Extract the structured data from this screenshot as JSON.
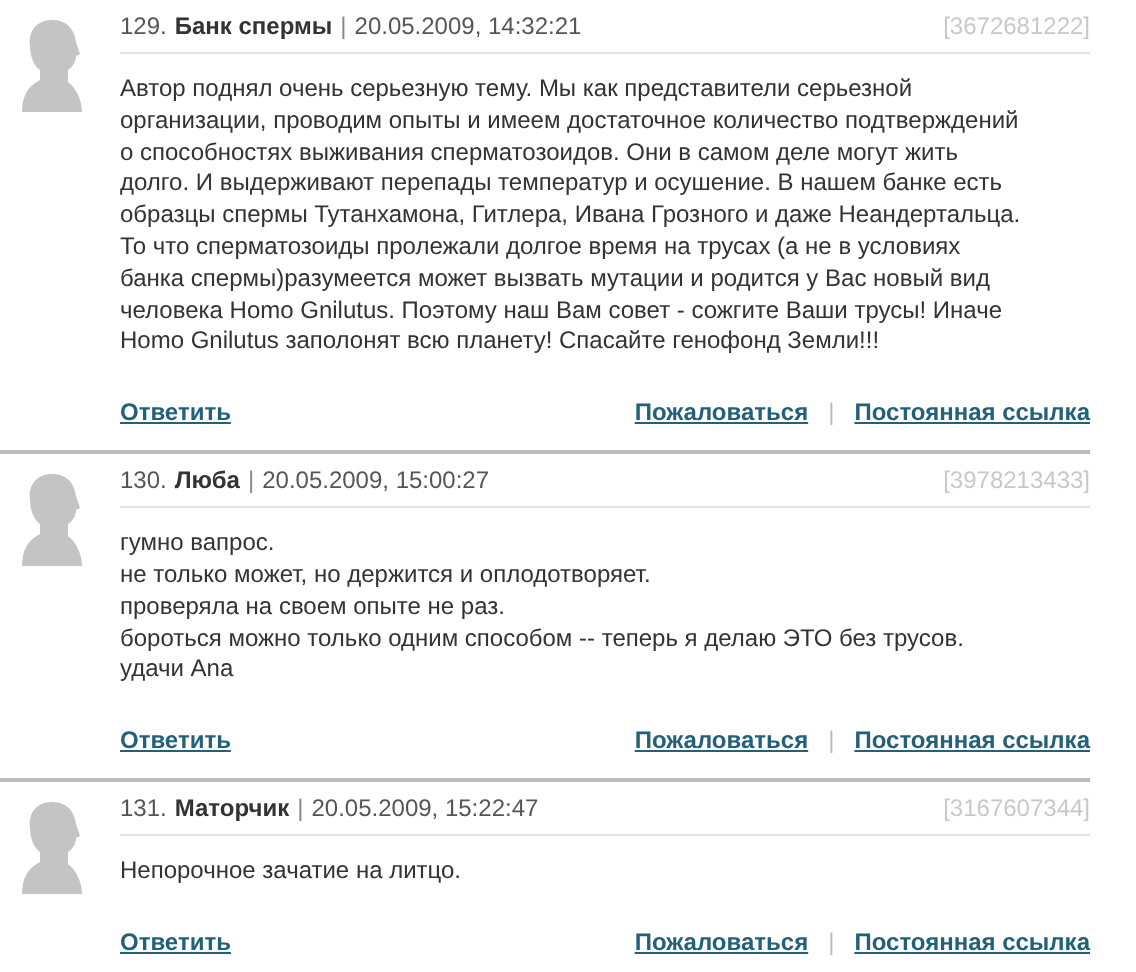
{
  "comments": [
    {
      "number": "129.",
      "author": "Банк спермы",
      "divider": "|",
      "date": "20.05.2009, 14:32:21",
      "id": "[3672681222]",
      "lines": [
        "Автор поднял очень серьезную тему. Мы как представители серьезной",
        "организации, проводим опыты и имеем достаточное количество подтверждений",
        "о способностях выживания сперматозоидов. Они в самом деле могут жить",
        "долго. И выдерживают перепады температур и осушение. В нашем банке есть",
        "образцы спермы Тутанхамона, Гитлера, Ивана Грозного и даже Неандертальца.",
        "То что сперматозоиды пролежали долгое время на трусах (а не в условиях",
        "банка спермы)разумеется может вызвать мутации и родится у Вас новый вид",
        "человека Homo Gnilutus. Поэтому наш Вам совет - сожгите Ваши трусы! Иначе",
        "Homo Gnilutus заполонят всю планету! Спасайте генофонд Земли!!!"
      ],
      "reply": "Ответить",
      "complain": "Пожаловаться",
      "link_divider": "|",
      "permalink": "Постоянная ссылка"
    },
    {
      "number": "130.",
      "author": "Люба",
      "divider": "|",
      "date": "20.05.2009, 15:00:27",
      "id": "[3978213433]",
      "lines": [
        "гумно вапрос.",
        "не только может, но держится и оплодотворяет.",
        "проверяла на своем опыте не раз.",
        "бороться можно только одним способом -- теперь я делаю ЭТО без трусов.",
        "удачи Ana"
      ],
      "reply": "Ответить",
      "complain": "Пожаловаться",
      "link_divider": "|",
      "permalink": "Постоянная ссылка"
    },
    {
      "number": "131.",
      "author": "Маторчик",
      "divider": "|",
      "date": "20.05.2009, 15:22:47",
      "id": "[3167607344]",
      "lines": [
        "Непорочное зачатие на литцо."
      ],
      "reply": "Ответить",
      "complain": "Пожаловаться",
      "link_divider": "|",
      "permalink": "Постоянная ссылка"
    }
  ]
}
